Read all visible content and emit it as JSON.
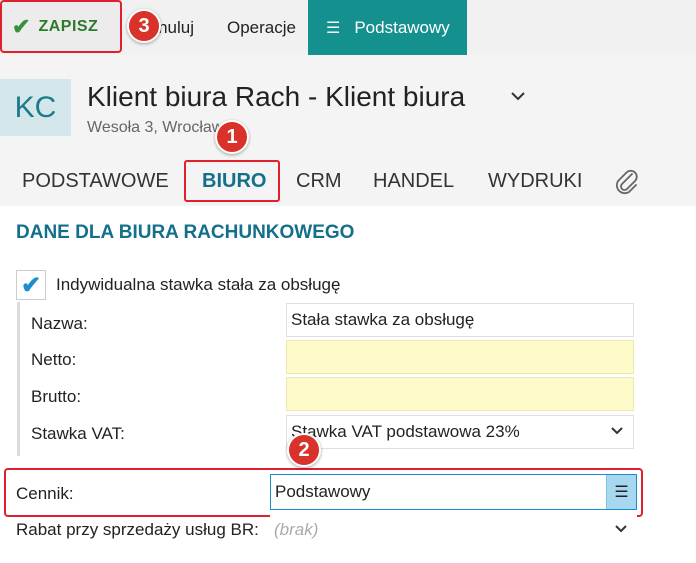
{
  "toolbar": {
    "save_label": "ZAPISZ",
    "cancel_label": "Anuluj",
    "operations_label": "Operacje",
    "profile_label": "Podstawowy",
    "profile_color": "#14908f"
  },
  "annotations": {
    "badge1": "1",
    "badge2": "2",
    "badge3": "3",
    "highlight_color": "#e0202a"
  },
  "header": {
    "avatar_initials": "KC",
    "title": "Klient biura Rach - Klient biura",
    "address": "Wesoła 3,  Wrocław"
  },
  "tabs": [
    {
      "label": "PODSTAWOWE"
    },
    {
      "label": "BIURO",
      "active": true
    },
    {
      "label": "CRM"
    },
    {
      "label": "HANDEL"
    },
    {
      "label": "WYDRUKI"
    }
  ],
  "section": {
    "title": "DANE DLA BIURA RACHUNKOWEGO",
    "checkbox_label": "Indywidualna stawka stała za obsługę",
    "checkbox_checked": true
  },
  "fields": {
    "nazwa_label": "Nazwa:",
    "nazwa_value": "Stała stawka za obsługę",
    "netto_label": "Netto:",
    "netto_value": "",
    "brutto_label": "Brutto:",
    "brutto_value": "",
    "vat_label": "Stawka VAT:",
    "vat_value": "Stawka VAT podstawowa 23%",
    "cennik_label": "Cennik:",
    "cennik_value": "Podstawowy",
    "rabat_label": "Rabat przy sprzedaży usług BR:",
    "rabat_value": "(brak)"
  }
}
